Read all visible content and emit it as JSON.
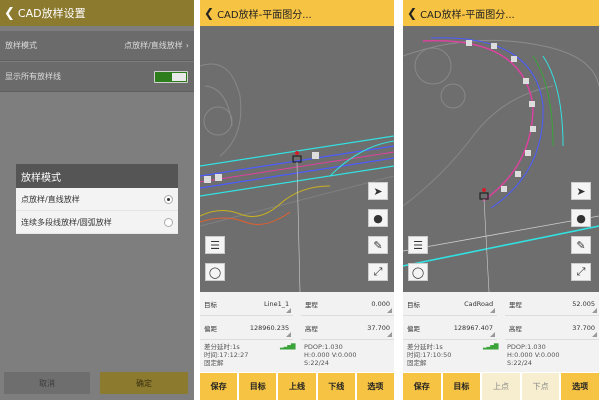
{
  "panel1": {
    "title": "CAD放样设置",
    "rows": [
      {
        "label": "放样模式",
        "value": "点放样/直线放样"
      },
      {
        "label": "显示所有放样线"
      }
    ],
    "modal": {
      "title": "放样模式",
      "options": [
        {
          "label": "点放样/直线放样",
          "selected": true
        },
        {
          "label": "连续多段线放样/圆弧放样",
          "selected": false
        }
      ]
    },
    "buttons": {
      "cancel": "取消",
      "confirm": "确定"
    }
  },
  "panel2": {
    "title": "CAD放样-平面图分...",
    "info": {
      "target_label": "目标",
      "target_value": "Line1_1",
      "mileage_label": "里程",
      "mileage_value": "0.000",
      "offset_label": "偏距",
      "offset_value": "128960.235",
      "elevation_label": "高程",
      "elevation_value": "37.700",
      "diff_delay": "差分延时:1s",
      "time": "时间:17:12:27",
      "fix": "固定解",
      "pdop": "PDOP:1.030",
      "hv": "H:0.000  V:0.000",
      "sats": "S:22/24"
    },
    "buttons": [
      "保存",
      "目标",
      "上线",
      "下线",
      "选项"
    ]
  },
  "panel3": {
    "title": "CAD放样-平面图分...",
    "info": {
      "target_label": "目标",
      "target_value": "CadRoad",
      "mileage_label": "里程",
      "mileage_value": "52.005",
      "offset_label": "偏距",
      "offset_value": "128967.407",
      "elevation_label": "高程",
      "elevation_value": "37.700",
      "diff_delay": "差分延时:1s",
      "time": "时间:17:10:50",
      "fix": "固定解",
      "pdop": "PDOP:1.030",
      "hv": "H:0.000  V:0.000",
      "sats": "S:22/24"
    },
    "buttons": [
      "保存",
      "目标",
      "上点",
      "下点",
      "选项"
    ]
  },
  "icons": {
    "back": "back-arrow-icon",
    "menu": "menu-icon",
    "satellite": "satellite-icon",
    "locate": "gps-locate-icon",
    "layers": "layers-icon",
    "compass": "compass-icon",
    "cursor": "cursor-icon",
    "bomb": "bomb-icon",
    "brush": "brush-icon",
    "fullscreen": "fullscreen-icon",
    "signal": "signal-bars-icon"
  },
  "colors": {
    "panel1_header": "#8c7a2f",
    "map_header": "#f6c343",
    "toggle_on": "#2e7d1c",
    "road_cyan": "#33e0e0",
    "road_blue": "#4b5cff",
    "road_magenta": "#e040a0"
  }
}
